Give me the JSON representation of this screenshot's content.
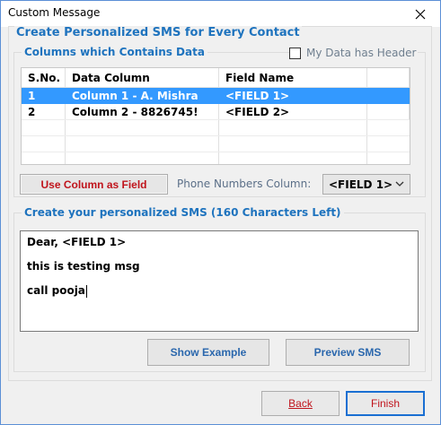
{
  "window": {
    "title": "Custom Message"
  },
  "outer_group": {
    "legend": "Create Personalized SMS for Every Contact"
  },
  "columns_group": {
    "legend": "Columns which Contains Data",
    "has_header_label": "My Data has Header",
    "has_header_checked": false,
    "headers": [
      "S.No.",
      "Data Column",
      "Field Name"
    ],
    "rows": [
      {
        "sno": "1",
        "data_column": "Column 1 - A. Mishra",
        "field_name": "<FIELD 1>",
        "selected": true
      },
      {
        "sno": "2",
        "data_column": "Column 2 - 8826745!",
        "field_name": "<FIELD 2>",
        "selected": false
      }
    ]
  },
  "use_column_button": "Use Column as Field",
  "phone_numbers": {
    "label": "Phone Numbers Column:",
    "selected": "<FIELD 1>"
  },
  "sms_group": {
    "legend": "Create your personalized SMS (160 Characters Left)",
    "lines": [
      "Dear, <FIELD 1>",
      "this is testing msg",
      "call pooja"
    ]
  },
  "buttons": {
    "show_example": "Show Example",
    "preview_sms": "Preview SMS",
    "back": "Back",
    "finish": "Finish"
  },
  "colors": {
    "accent": "#1e73be",
    "selection": "#3399ff",
    "danger_text": "#c0141c"
  },
  "icons": {
    "close": "close-icon",
    "dropdown": "chevron-down-icon"
  }
}
